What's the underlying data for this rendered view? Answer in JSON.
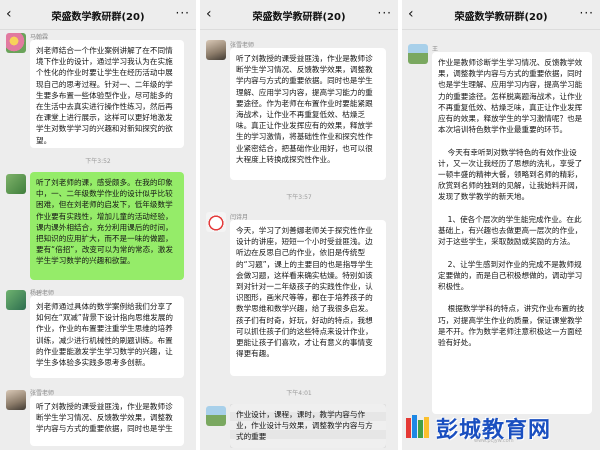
{
  "chat_title": "荣盛数学教研群(20)",
  "header_icons": {
    "back": "back-chevron-icon",
    "more": "more-dots-icon"
  },
  "colors": {
    "background": "#ededed",
    "own_bubble": "#95ec69",
    "other_bubble": "#ffffff",
    "watermark": "#1a4fc0"
  },
  "panel1": {
    "msg1": {
      "sender": "马翰霖",
      "text": "刘老师结合一个作业案例讲解了在不同情境下作业的设计，通过学习我认为在实施个性化的作业时要让学生在经历活动中展现自己的思考过程。针对一、二年级的学生要多布置一些体验型作业，尽可能多的在生活中去真实进行操作性练习，然后再在课堂上进行展示，这样可以更好地激发学生对数学学习的兴趣和对新知探究的欲望。"
    },
    "time1": "下午3:52",
    "msg2": {
      "text": "听了刘老师的课，感受颇多。在我的印象中，一、二年级数学作业的设计似乎比较困难，但在刘老师的启发下，低年级数学作业要有实践性，增加儿童的活动经验，课内课外相结合，充分利用课后的时间，把知识的应用扩大，而不是一味的做题，要有“倍招”，改变可以为常的常态，激发学生学习数学的兴趣和欲望。"
    },
    "msg3": {
      "sender": "杨碧老师",
      "text": "刘老师通过具体的数学案例给我们分享了如何在“双减”背景下设计指向思维发展的作业，作业的布置要注重学生思维的培养训练，减少进行机械性的刷题训练。布置的作业要能激发学生学习数学的兴趣，让学生多体验多实践多思考多创新。"
    },
    "msg4": {
      "sender": "张雪老师",
      "text": "听了刘教授的课受益匪浅，作业是教师诊断学生学习情况、反馈教学效果，调整教学内容与方式的重要依据，同时也是学生"
    }
  },
  "panel2": {
    "msg1": {
      "sender": "张雪老师",
      "text": "听了刘教授的课受益匪浅，作业是教师诊断学生学习情况、反馈教学效果，调整教学内容与方式的重要依据。同时也是学生理解、应用学习内容，提高学习能力的重要途径。作为老师在布置作业时要能紧跟海战术，让作业不再重复低效、枯燥乏味。真正让作业发挥应有的效果，释放学生的学习激情，将基础性作业和探究性作业紧密结合，把基础作业用好，也可以很大程度上转换成探究性作业。"
    },
    "time1": "下午3:57",
    "msg2": {
      "sender": "闫诗月",
      "text": "今天，学习了刘善娜老师关于探究性作业设计的讲座，短短一个小时受益匪浅。边听边在反思自己的作业，依旧是传统型的“习题”，课上的主要目的也是指导学生会做习题，这样看来确实枯燥。特别如该到对针对一二年级孩子的实践性作业，认识图形，画米尺等等，都在于培养孩子的数学思维和数学兴趣，给了我很多启发。孩子们有时奇，好玩，好动的特点，我想可以抓住孩子们的这些特点来设计作业，更能让孩子们喜欢，才让有意义的事情变得更有趣。"
    },
    "time2": "下午4:01",
    "msg3": {
      "text": "作业设计，课程，课时，教学内容与作业，作业设计与效果，调整教学内容与方式的重要"
    }
  },
  "panel3": {
    "msg1": {
      "sender": "王",
      "text": "作业是教师诊断学生学习情况、反馈教学效果，调整教学内容与方式的重要依据，同时也是学生理解、应用学习内容，提高学习能力的重要途径。怎样脱离题海战术，让作业不再重复低效、枯燥乏味，真正让作业发挥应有的效果，释放学生的学习激情呢？也是本次培训特色数学作业最重要的环节。\n\n    今天有幸听到对数学特色的有效作业设计，又一次让我经历了思想的洗礼，享受了一顿丰盛的精神大餐，领略到名师的精彩，欣赏到名师的独到的见解，让我始料开阔，发现了数学教学的新天地。\n\n    1、使各个层次的学生能完成作业。在此基础上，有兴趣也去做更高一层次的作业，对于这些学生，采取鼓励或奖励的方法。\n\n    2、让学生感到对作业的完成不是教师规定要做的，而是自己积极想做的，调动学习积极性。\n\n    根据数学学科的特点，讲究作业布置的技巧，对提高学生作业的质量，保证课堂教学是不开。作为数学老师注意积极这一方面经验有好处。"
    }
  },
  "watermark": {
    "text": "彭城教育网",
    "url": "www.pcjyw.com"
  }
}
